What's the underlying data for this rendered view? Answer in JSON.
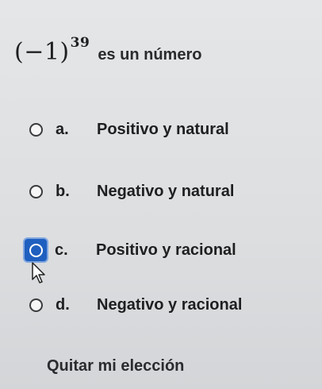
{
  "question": {
    "base": "(−1)",
    "exponent": "39",
    "text": "es un número"
  },
  "options": [
    {
      "letter": "a.",
      "label": "Positivo y natural",
      "selected": false
    },
    {
      "letter": "b.",
      "label": "Negativo y natural",
      "selected": false
    },
    {
      "letter": "c.",
      "label": "Positivo y racional",
      "selected": true
    },
    {
      "letter": "d.",
      "label": "Negativo y racional",
      "selected": false
    }
  ],
  "clear_choice": "Quitar mi elección",
  "colors": {
    "focus": "#1f5fbf",
    "text": "#1e1f21"
  }
}
